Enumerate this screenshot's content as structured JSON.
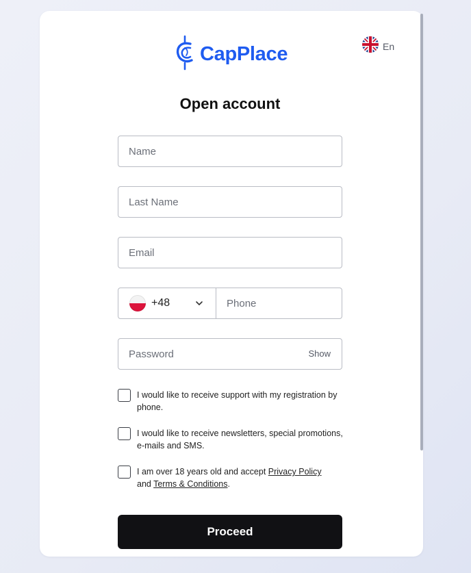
{
  "brand": {
    "name": "CapPlace",
    "accent": "#1f5cf0",
    "icon": "capplace-logo-icon"
  },
  "language": {
    "label": "En",
    "icon": "uk-flag-icon"
  },
  "form": {
    "title": "Open account",
    "name_placeholder": "Name",
    "last_name_placeholder": "Last Name",
    "email_placeholder": "Email",
    "phone": {
      "country_code": "+48",
      "country_flag_icon": "poland-flag-icon",
      "placeholder": "Phone"
    },
    "password_placeholder": "Password",
    "show_label": "Show",
    "checkboxes": [
      {
        "text": "I would like to receive support with my registration by phone.",
        "checked": false
      },
      {
        "text": "I would like to receive newsletters, special promotions, e-mails and SMS.",
        "checked": false
      },
      {
        "text_prefix": "I am over 18 years old and accept ",
        "privacy_link": "Privacy Policy",
        "text_middle": " and ",
        "terms_link": "Terms & Conditions",
        "text_suffix": ".",
        "checked": false
      }
    ],
    "submit_label": "Proceed"
  }
}
